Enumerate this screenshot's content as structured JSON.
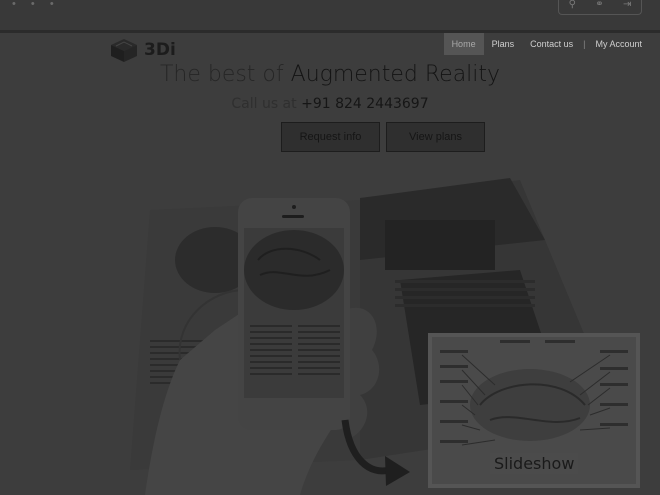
{
  "topbar": {
    "dots": "• • •",
    "icons": [
      "⚲",
      "⚭",
      "⇥"
    ]
  },
  "logo": {
    "text": "3Di"
  },
  "nav": {
    "items": [
      "Home",
      "Plans",
      "Contact us",
      "My Account"
    ],
    "active": 0
  },
  "hero": {
    "headline_light": "The best of",
    "headline_strong": "Augmented Reality",
    "call_label": "Call us at",
    "phone": "+91 824 2443697",
    "buttons": {
      "request": "Request info",
      "plans": "View plans"
    },
    "slideshow_label": "Slideshow"
  }
}
